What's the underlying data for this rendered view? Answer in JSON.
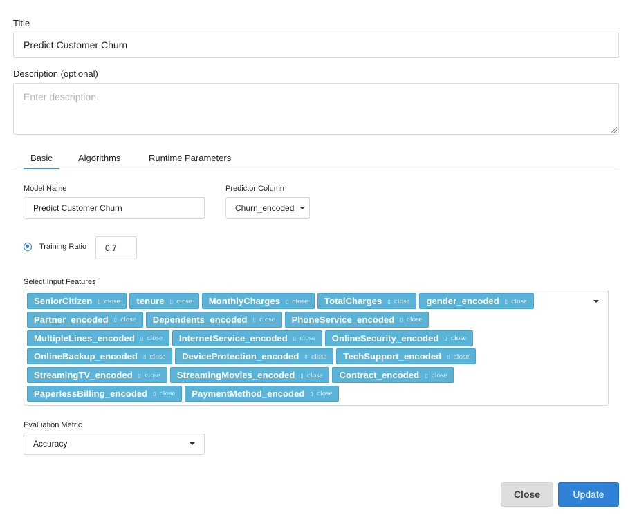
{
  "form": {
    "title_label": "Title",
    "title_value": "Predict Customer Churn",
    "description_label": "Description (optional)",
    "description_placeholder": "Enter description"
  },
  "tabs": [
    {
      "label": "Basic",
      "active": true
    },
    {
      "label": "Algorithms",
      "active": false
    },
    {
      "label": "Runtime Parameters",
      "active": false
    }
  ],
  "basic": {
    "model_name_label": "Model Name",
    "model_name_value": "Predict Customer Churn",
    "predictor_label": "Predictor Column",
    "predictor_value": "Churn_encoded",
    "training_ratio_label": "Training Ratio",
    "training_ratio_value": "0.7",
    "features_label": "Select Input Features",
    "tag_close_glyph": "▯",
    "tag_close_label": "close",
    "feature_rows": [
      [
        "SeniorCitizen",
        "tenure",
        "MonthlyCharges",
        "TotalCharges",
        "gender_encoded"
      ],
      [
        "Partner_encoded",
        "Dependents_encoded",
        "PhoneService_encoded"
      ],
      [
        "MultipleLines_encoded",
        "InternetService_encoded",
        "OnlineSecurity_encoded"
      ],
      [
        "OnlineBackup_encoded",
        "DeviceProtection_encoded",
        "TechSupport_encoded"
      ],
      [
        "StreamingTV_encoded",
        "StreamingMovies_encoded",
        "Contract_encoded"
      ],
      [
        "PaperlessBilling_encoded",
        "PaymentMethod_encoded"
      ]
    ],
    "metric_label": "Evaluation Metric",
    "metric_value": "Accuracy"
  },
  "footer": {
    "close_label": "Close",
    "update_label": "Update"
  },
  "colors": {
    "accent": "#3082d6",
    "tag_bg": "#5bb4d8"
  }
}
